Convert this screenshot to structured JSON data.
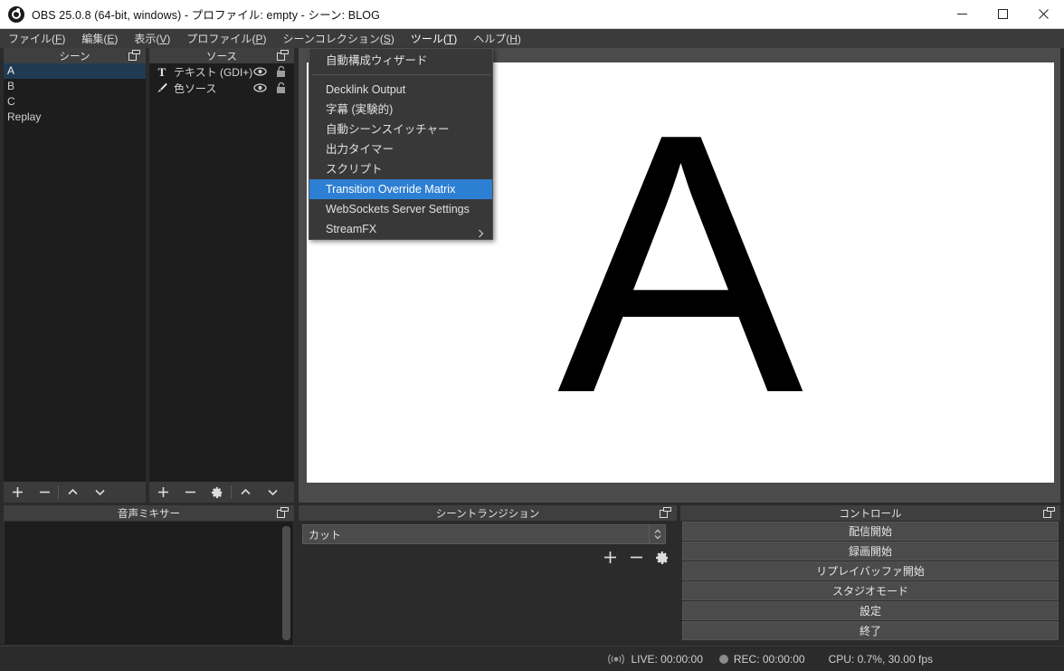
{
  "window": {
    "title": "OBS 25.0.8 (64-bit, windows) - プロファイル: empty - シーン: BLOG",
    "app_icon": "obs-logo-icon",
    "minimize_label": "minimize",
    "maximize_label": "maximize",
    "close_label": "close"
  },
  "menubar": {
    "items": [
      {
        "text": "ファイル",
        "accel": "F"
      },
      {
        "text": "編集",
        "accel": "E"
      },
      {
        "text": "表示",
        "accel": "V"
      },
      {
        "text": "プロファイル",
        "accel": "P"
      },
      {
        "text": "シーンコレクション",
        "accel": "S"
      },
      {
        "text": "ツール",
        "accel": "T"
      },
      {
        "text": "ヘルプ",
        "accel": "H"
      }
    ]
  },
  "tools_menu": {
    "open": true,
    "items": [
      {
        "label": "自動構成ウィザード",
        "highlighted": false,
        "submenu": false
      },
      {
        "separator": true
      },
      {
        "label": "Decklink Output",
        "highlighted": false,
        "submenu": false
      },
      {
        "label": "字幕 (実験的)",
        "highlighted": false,
        "submenu": false
      },
      {
        "label": "自動シーンスイッチャー",
        "highlighted": false,
        "submenu": false
      },
      {
        "label": "出力タイマー",
        "highlighted": false,
        "submenu": false
      },
      {
        "label": "スクリプト",
        "highlighted": false,
        "submenu": false
      },
      {
        "label": "Transition Override Matrix",
        "highlighted": true,
        "submenu": false
      },
      {
        "label": "WebSockets Server Settings",
        "highlighted": false,
        "submenu": false
      },
      {
        "label": "StreamFX",
        "highlighted": false,
        "submenu": true
      }
    ],
    "highlight_color": "#2d7fd3"
  },
  "scenes_dock": {
    "title": "シーン",
    "float_icon": "float-dock-icon",
    "items": [
      {
        "name": "A",
        "selected": true
      },
      {
        "name": "B",
        "selected": false
      },
      {
        "name": "C",
        "selected": false
      },
      {
        "name": "Replay",
        "selected": false
      }
    ],
    "selected_color": "#1f3a52",
    "toolbar": [
      {
        "icon": "plus-icon",
        "name": "add-scene-button"
      },
      {
        "icon": "minus-icon",
        "name": "remove-scene-button"
      },
      {
        "icon": "chevron-up-icon",
        "name": "move-scene-up-button"
      },
      {
        "icon": "chevron-down-icon",
        "name": "move-scene-down-button"
      }
    ]
  },
  "sources_dock": {
    "title": "ソース",
    "float_icon": "float-dock-icon",
    "items": [
      {
        "label": "テキスト (GDI+)",
        "icon": "text-source-icon",
        "visible": true,
        "locked": false
      },
      {
        "label": "色ソース",
        "icon": "color-source-icon",
        "visible": true,
        "locked": false
      }
    ],
    "toolbar": [
      {
        "icon": "plus-icon",
        "name": "add-source-button"
      },
      {
        "icon": "minus-icon",
        "name": "remove-source-button"
      },
      {
        "icon": "gear-icon",
        "name": "source-properties-button"
      },
      {
        "icon": "chevron-up-icon",
        "name": "move-source-up-button"
      },
      {
        "icon": "chevron-down-icon",
        "name": "move-source-down-button"
      }
    ]
  },
  "mixer_dock": {
    "title": "音声ミキサー",
    "float_icon": "float-dock-icon",
    "channels": []
  },
  "preview": {
    "canvas_text": "A",
    "canvas_bg": "#ffffff",
    "text_color": "#000000"
  },
  "transitions_dock": {
    "title": "シーントランジション",
    "float_icon": "float-dock-icon",
    "selected_transition": "カット",
    "buttons": [
      {
        "icon": "plus-icon",
        "name": "add-transition-button"
      },
      {
        "icon": "minus-icon",
        "name": "remove-transition-button"
      },
      {
        "icon": "gear-icon",
        "name": "transition-properties-button"
      }
    ]
  },
  "controls_dock": {
    "title": "コントロール",
    "float_icon": "float-dock-icon",
    "buttons": [
      {
        "label": "配信開始",
        "name": "start-streaming-button"
      },
      {
        "label": "録画開始",
        "name": "start-recording-button"
      },
      {
        "label": "リプレイバッファ開始",
        "name": "start-replay-buffer-button"
      },
      {
        "label": "スタジオモード",
        "name": "studio-mode-button"
      },
      {
        "label": "設定",
        "name": "settings-button"
      },
      {
        "label": "終了",
        "name": "exit-button"
      }
    ]
  },
  "statusbar": {
    "live_label": "LIVE: 00:00:00",
    "rec_label": "REC: 00:00:00",
    "cpu_label": "CPU: 0.7%, 30.00 fps"
  }
}
